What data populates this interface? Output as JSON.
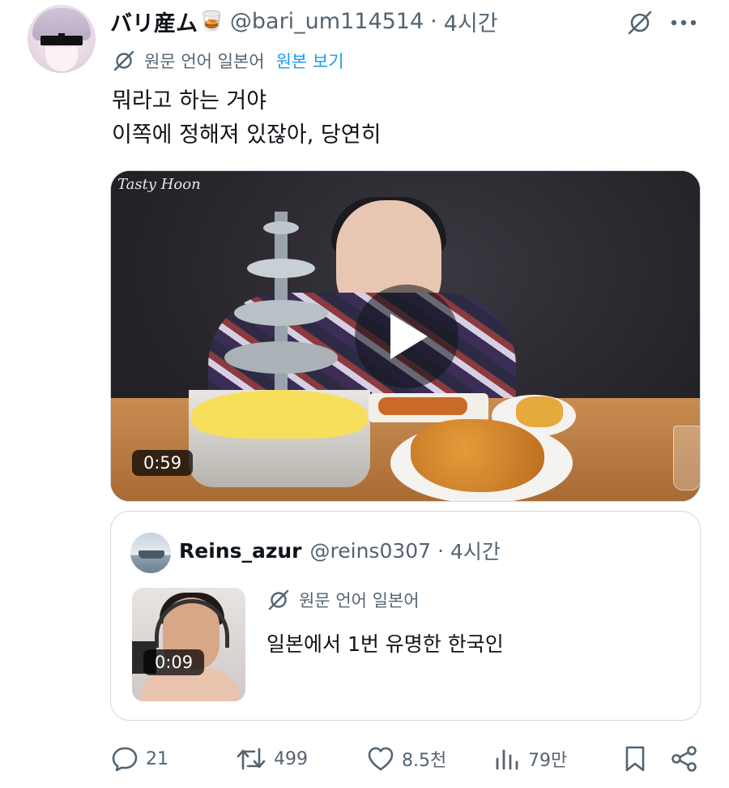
{
  "post": {
    "display_name": "バリ産ム",
    "emoji": "🥃",
    "handle": "@bari_um114514",
    "separator": "·",
    "time": "4시간",
    "translation_label": "원문 언어 일본어",
    "show_original": "원본 보기",
    "text_lines": [
      "뭐라고 하는 거야",
      "이쪽에 정해져 있잖아, 당연히"
    ],
    "media": {
      "watermark": "Tasty Hoon",
      "duration": "0:59"
    }
  },
  "quote": {
    "display_name": "Reins_azur",
    "handle": "@reins0307",
    "separator": "·",
    "time": "4시간",
    "translation_label": "원문 언어 일본어",
    "text": "일본에서 1번 유명한 한국인",
    "duration": "0:09"
  },
  "actions": {
    "replies": "21",
    "reposts": "499",
    "likes": "8.5천",
    "views": "79만"
  },
  "colors": {
    "text": "#0f1419",
    "secondary": "#536471",
    "link": "#1d9bf0",
    "border": "#cfd9de"
  },
  "icons": [
    "grok-icon",
    "more-icon",
    "translate-icon",
    "play-icon",
    "reply-icon",
    "repost-icon",
    "like-icon",
    "views-icon",
    "bookmark-icon",
    "share-icon"
  ]
}
